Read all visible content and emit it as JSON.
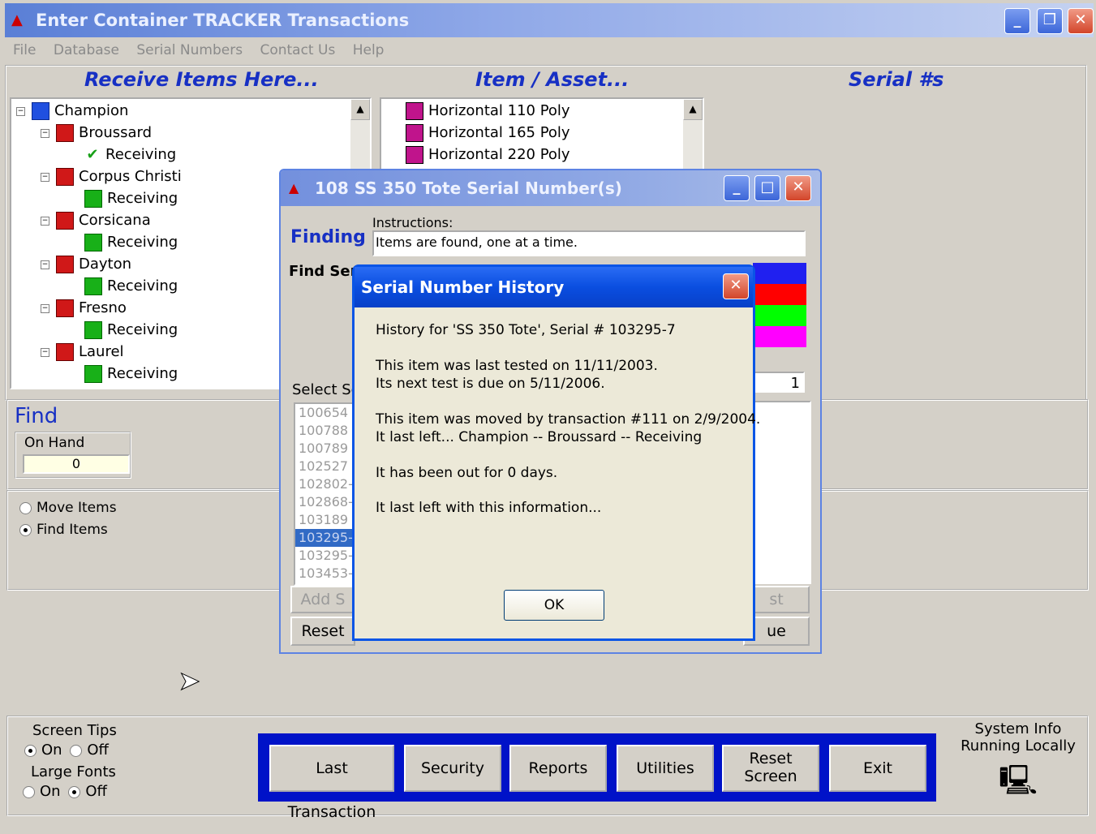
{
  "window": {
    "title": "Enter Container TRACKER Transactions"
  },
  "menu": [
    "File",
    "Database",
    "Serial Numbers",
    "Contact Us",
    "Help"
  ],
  "headers": {
    "receive": "Receive Items Here...",
    "item": "Item / Asset...",
    "serial": "Serial #s"
  },
  "tree": {
    "root": "Champion",
    "locations": [
      {
        "name": "Broussard",
        "child": "Receiving"
      },
      {
        "name": "Corpus Christi",
        "child": "Receiving"
      },
      {
        "name": "Corsicana",
        "child": "Receiving"
      },
      {
        "name": "Dayton",
        "child": "Receiving"
      },
      {
        "name": "Fresno",
        "child": "Receiving"
      },
      {
        "name": "Laurel",
        "child": "Receiving"
      }
    ]
  },
  "items": [
    "Horizontal 110 Poly",
    "Horizontal 165 Poly",
    "Horizontal 220 Poly"
  ],
  "find": {
    "title": "Find",
    "on_hand_label": "On Hand",
    "on_hand_value": "0"
  },
  "mode": {
    "move": "Move Items",
    "find": "Find Items",
    "selected": "find"
  },
  "serial_window": {
    "title": "108 SS 350 Tote Serial Number(s)",
    "mode_label": "Finding",
    "instructions_label": "Instructions:",
    "instructions": "Items are found, one at a time.",
    "find_label": "Find Seri",
    "select_label": "Select Se",
    "count": "1",
    "serials": [
      "100654",
      "100788",
      "100789",
      "102527",
      "102802-",
      "102868-",
      "103189",
      "103295-",
      "103295-",
      "103453-"
    ],
    "selected_index": 7,
    "add_button": "Add S",
    "reset_button": "Reset",
    "right_button_1": "st",
    "right_button_2": "ue",
    "colors": [
      "#2020f0",
      "#ff0000",
      "#00ff00",
      "#ff00ff"
    ]
  },
  "history": {
    "title": "Serial Number History",
    "lines": [
      "History for     'SS 350 Tote', Serial # 103295-7",
      "This item was last tested on 11/11/2003.",
      "Its next test is due on 5/11/2006.",
      "This item was moved by transaction #111 on  2/9/2004.",
      "It last left...  Champion -- Broussard -- Receiving",
      "It has been out for 0 days.",
      "It last left with this information..."
    ],
    "ok": "OK"
  },
  "settings": {
    "screen_tips": "Screen Tips",
    "large_fonts": "Large Fonts",
    "on": "On",
    "off": "Off"
  },
  "toolbar": [
    "Last Transaction",
    "Security",
    "Reports",
    "Utilities",
    "Reset Screen",
    "Exit"
  ],
  "system": {
    "line1": "System Info",
    "line2": "Running Locally"
  }
}
